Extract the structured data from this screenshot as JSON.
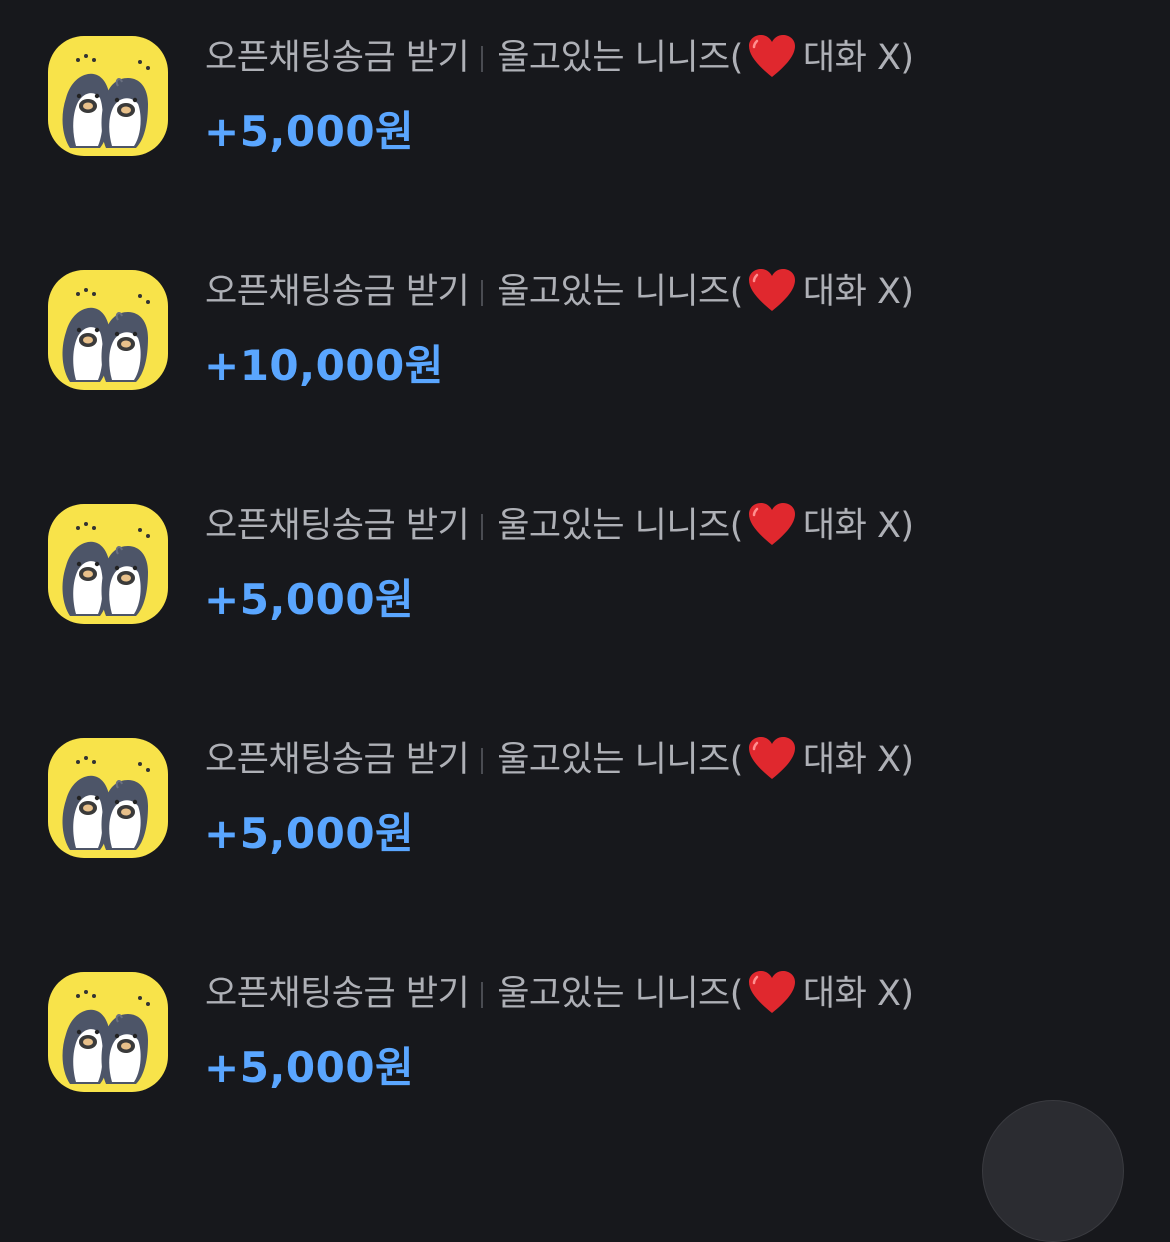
{
  "transactions": [
    {
      "type_label": "오픈채팅송금 받기",
      "sender_prefix": "울고있는 니니즈(",
      "sender_suffix": "대화 X)",
      "amount": "+5,000원",
      "avatar_icon": "ninini-penguin-avatar-icon",
      "heart_icon": "red-heart-emoji-icon"
    },
    {
      "type_label": "오픈채팅송금 받기",
      "sender_prefix": "울고있는 니니즈(",
      "sender_suffix": "대화 X)",
      "amount": "+10,000원",
      "avatar_icon": "ninini-penguin-avatar-icon",
      "heart_icon": "red-heart-emoji-icon"
    },
    {
      "type_label": "오픈채팅송금 받기",
      "sender_prefix": "울고있는 니니즈(",
      "sender_suffix": "대화 X)",
      "amount": "+5,000원",
      "avatar_icon": "ninini-penguin-avatar-icon",
      "heart_icon": "red-heart-emoji-icon"
    },
    {
      "type_label": "오픈채팅송금 받기",
      "sender_prefix": "울고있는 니니즈(",
      "sender_suffix": "대화 X)",
      "amount": "+5,000원",
      "avatar_icon": "ninini-penguin-avatar-icon",
      "heart_icon": "red-heart-emoji-icon"
    },
    {
      "type_label": "오픈채팅송금 받기",
      "sender_prefix": "울고있는 니니즈(",
      "sender_suffix": "대화 X)",
      "amount": "+5,000원",
      "avatar_icon": "ninini-penguin-avatar-icon",
      "heart_icon": "red-heart-emoji-icon"
    }
  ],
  "colors": {
    "background": "#17181c",
    "title_text": "#aeb0b6",
    "amount_text": "#5aa6ff",
    "avatar_background": "#f8e34a",
    "heart": "#e0282e"
  }
}
